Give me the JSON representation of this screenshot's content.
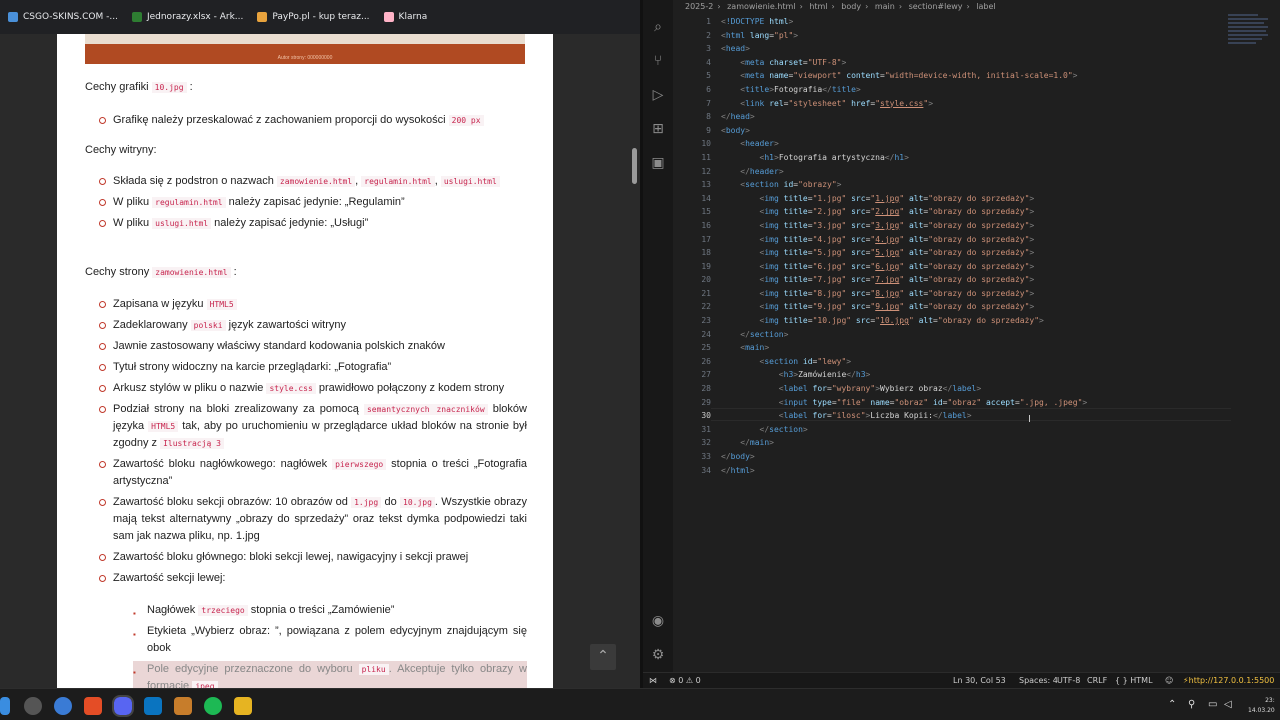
{
  "bookmarks": [
    {
      "label": "CSGO-SKINS.COM -...",
      "color": "#4a90d9"
    },
    {
      "label": "Jednorazy.xlsx - Ark...",
      "color": "#2e7d32"
    },
    {
      "label": "PayPo.pl - kup teraz...",
      "color": "#e8a33d"
    },
    {
      "label": "Klarna",
      "color": "#ffb3c7"
    }
  ],
  "doc": {
    "banner_text": "Autor strony: 000000000",
    "h1_pre": "Cechy grafiki",
    "h1_code": "10.jpg",
    "h1_post": ":",
    "grafika_pre": "Grafikę należy przeskalować z zachowaniem proporcji do wysokości",
    "grafika_code": "200 px",
    "h2": "Cechy witryny:",
    "w1_pre": "Składa się z podstron o nazwach",
    "w1_c1": "zamowienie.html",
    "w1_c2": "regulamin.html",
    "w1_c3": "uslugi.html",
    "w2_pre": "W pliku",
    "w2_code": "regulamin.html",
    "w2_post": "należy zapisać jedynie: „Regulamin”",
    "w3_pre": "W pliku",
    "w3_code": "uslugi.html",
    "w3_post": "należy zapisać jedynie: „Usługi”",
    "h3_pre": "Cechy strony",
    "h3_code": "zamowienie.html",
    "h3_post": ":",
    "s1_pre": "Zapisana w języku",
    "s1_code": "HTML5",
    "s2_pre": "Zadeklarowany",
    "s2_code": "polski",
    "s2_post": "język zawartości witryny",
    "s3": "Jawnie zastosowany właściwy standard kodowania polskich znaków",
    "s4": "Tytuł strony widoczny na karcie przeglądarki: „Fotografia”",
    "s5_pre": "Arkusz stylów w pliku o nazwie",
    "s5_code": "style.css",
    "s5_post": "prawidłowo połączony z kodem strony",
    "s6_pre": "Podział strony na bloki zrealizowany za pomocą",
    "s6_code": "semantycznych znaczników",
    "s6_mid": "bloków języka",
    "s6_code2": "HTML5",
    "s6_post": "tak, aby po uruchomieniu w przeglądarce układ bloków na stronie był zgodny z",
    "s6_code3": "Ilustracją 3",
    "s7_pre": "Zawartość bloku nagłówkowego: nagłówek",
    "s7_code": "pierwszego",
    "s7_post": "stopnia o treści „Fotografia artystyczna”",
    "s8_pre": "Zawartość bloku sekcji obrazów: 10 obrazów od",
    "s8_c1": "1.jpg",
    "s8_mid": "do",
    "s8_c2": "10.jpg",
    "s8_post": ". Wszystkie obrazy mają tekst alternatywny „obrazy do sprzedaży” oraz tekst dymka podpowiedzi taki sam jak nazwa pliku, np. 1.jpg",
    "s9": "Zawartość bloku głównego: bloki sekcji lewej, nawigacyjny i sekcji prawej",
    "s10": "Zawartość sekcji lewej:",
    "sub1_pre": "Nagłówek",
    "sub1_code": "trzeciego",
    "sub1_post": "stopnia o treści „Zamówienie”",
    "sub2": "Etykieta „Wybierz obraz: ”, powiązana z polem edycyjnym znajdującym się obok",
    "sub3_pre": "Pole edycyjne przeznaczone do wyboru",
    "sub3_code": "pliku",
    "sub3_post": ". Akceptuje tylko obrazy w formacie",
    "sub3_code2": "jpeg"
  },
  "editor": {
    "breadcrumb": [
      "2025-2",
      "›",
      "zamowienie.html",
      "›",
      "html",
      "›",
      "body",
      "›",
      "main",
      "›",
      "section#lewy",
      "›",
      "label"
    ],
    "lines": [
      {
        "n": "1",
        "html": "<span class='pu'>&lt;</span><span class='tg'>!DOCTYPE</span> <span class='at'>html</span><span class='pu'>&gt;</span>"
      },
      {
        "n": "2",
        "html": "<span class='pu'>&lt;</span><span class='tg'>html</span> <span class='at'>lang</span>=<span class='st'>\"pl\"</span><span class='pu'>&gt;</span>"
      },
      {
        "n": "3",
        "html": "<span class='pu'>&lt;</span><span class='tg'>head</span><span class='pu'>&gt;</span>"
      },
      {
        "n": "4",
        "html": "    <span class='pu'>&lt;</span><span class='tg'>meta</span> <span class='at'>charset</span>=<span class='st'>\"UTF-8\"</span><span class='pu'>&gt;</span>"
      },
      {
        "n": "5",
        "html": "    <span class='pu'>&lt;</span><span class='tg'>meta</span> <span class='at'>name</span>=<span class='st'>\"viewport\"</span> <span class='at'>content</span>=<span class='st'>\"width=device-width, initial-scale=1.0\"</span><span class='pu'>&gt;</span>"
      },
      {
        "n": "6",
        "html": "    <span class='pu'>&lt;</span><span class='tg'>title</span><span class='pu'>&gt;</span>Fotografia<span class='pu'>&lt;/</span><span class='tg'>title</span><span class='pu'>&gt;</span>"
      },
      {
        "n": "7",
        "html": "    <span class='pu'>&lt;</span><span class='tg'>link</span> <span class='at'>rel</span>=<span class='st'>\"stylesheet\"</span> <span class='at'>href</span>=<span class='st'>\"<span class='u'>style.css</span>\"</span><span class='pu'>&gt;</span>"
      },
      {
        "n": "8",
        "html": "<span class='pu'>&lt;/</span><span class='tg'>head</span><span class='pu'>&gt;</span>"
      },
      {
        "n": "9",
        "html": "<span class='pu'>&lt;</span><span class='tg'>body</span><span class='pu'>&gt;</span>"
      },
      {
        "n": "10",
        "html": "    <span class='pu'>&lt;</span><span class='tg'>header</span><span class='pu'>&gt;</span>"
      },
      {
        "n": "11",
        "html": "        <span class='pu'>&lt;</span><span class='tg'>h1</span><span class='pu'>&gt;</span>Fotografia artystyczna<span class='pu'>&lt;/</span><span class='tg'>h1</span><span class='pu'>&gt;</span>"
      },
      {
        "n": "12",
        "html": "    <span class='pu'>&lt;/</span><span class='tg'>header</span><span class='pu'>&gt;</span>"
      },
      {
        "n": "13",
        "html": "    <span class='pu'>&lt;</span><span class='tg'>section</span> <span class='at'>id</span>=<span class='st'>\"obrazy\"</span><span class='pu'>&gt;</span>"
      },
      {
        "n": "14",
        "html": "        <span class='pu'>&lt;</span><span class='tg'>img</span> <span class='at'>title</span>=<span class='st'>\"1.jpg\"</span> <span class='at'>src</span>=<span class='st'>\"<span class='u'>1.jpg</span>\"</span> <span class='at'>alt</span>=<span class='st'>\"obrazy do sprzedaży\"</span><span class='pu'>&gt;</span>"
      },
      {
        "n": "15",
        "html": "        <span class='pu'>&lt;</span><span class='tg'>img</span> <span class='at'>title</span>=<span class='st'>\"2.jpg\"</span> <span class='at'>src</span>=<span class='st'>\"<span class='u'>2.jpg</span>\"</span> <span class='at'>alt</span>=<span class='st'>\"obrazy do sprzedaży\"</span><span class='pu'>&gt;</span>"
      },
      {
        "n": "16",
        "html": "        <span class='pu'>&lt;</span><span class='tg'>img</span> <span class='at'>title</span>=<span class='st'>\"3.jpg\"</span> <span class='at'>src</span>=<span class='st'>\"<span class='u'>3.jpg</span>\"</span> <span class='at'>alt</span>=<span class='st'>\"obrazy do sprzedaży\"</span><span class='pu'>&gt;</span>"
      },
      {
        "n": "17",
        "html": "        <span class='pu'>&lt;</span><span class='tg'>img</span> <span class='at'>title</span>=<span class='st'>\"4.jpg\"</span> <span class='at'>src</span>=<span class='st'>\"<span class='u'>4.jpg</span>\"</span> <span class='at'>alt</span>=<span class='st'>\"obrazy do sprzedaży\"</span><span class='pu'>&gt;</span>"
      },
      {
        "n": "18",
        "html": "        <span class='pu'>&lt;</span><span class='tg'>img</span> <span class='at'>title</span>=<span class='st'>\"5.jpg\"</span> <span class='at'>src</span>=<span class='st'>\"<span class='u'>5.jpg</span>\"</span> <span class='at'>alt</span>=<span class='st'>\"obrazy do sprzedaży\"</span><span class='pu'>&gt;</span>"
      },
      {
        "n": "19",
        "html": "        <span class='pu'>&lt;</span><span class='tg'>img</span> <span class='at'>title</span>=<span class='st'>\"6.jpg\"</span> <span class='at'>src</span>=<span class='st'>\"<span class='u'>6.jpg</span>\"</span> <span class='at'>alt</span>=<span class='st'>\"obrazy do sprzedaży\"</span><span class='pu'>&gt;</span>"
      },
      {
        "n": "20",
        "html": "        <span class='pu'>&lt;</span><span class='tg'>img</span> <span class='at'>title</span>=<span class='st'>\"7.jpg\"</span> <span class='at'>src</span>=<span class='st'>\"<span class='u'>7.jpg</span>\"</span> <span class='at'>alt</span>=<span class='st'>\"obrazy do sprzedaży\"</span><span class='pu'>&gt;</span>"
      },
      {
        "n": "21",
        "html": "        <span class='pu'>&lt;</span><span class='tg'>img</span> <span class='at'>title</span>=<span class='st'>\"8.jpg\"</span> <span class='at'>src</span>=<span class='st'>\"<span class='u'>8.jpg</span>\"</span> <span class='at'>alt</span>=<span class='st'>\"obrazy do sprzedaży\"</span><span class='pu'>&gt;</span>"
      },
      {
        "n": "22",
        "html": "        <span class='pu'>&lt;</span><span class='tg'>img</span> <span class='at'>title</span>=<span class='st'>\"9.jpg\"</span> <span class='at'>src</span>=<span class='st'>\"<span class='u'>9.jpg</span>\"</span> <span class='at'>alt</span>=<span class='st'>\"obrazy do sprzedaży\"</span><span class='pu'>&gt;</span>"
      },
      {
        "n": "23",
        "html": "        <span class='pu'>&lt;</span><span class='tg'>img</span> <span class='at'>title</span>=<span class='st'>\"10.jpg\"</span> <span class='at'>src</span>=<span class='st'>\"<span class='u'>10.jpg</span>\"</span> <span class='at'>alt</span>=<span class='st'>\"obrazy do sprzedaży\"</span><span class='pu'>&gt;</span>"
      },
      {
        "n": "24",
        "html": "    <span class='pu'>&lt;/</span><span class='tg'>section</span><span class='pu'>&gt;</span>"
      },
      {
        "n": "25",
        "html": "    <span class='pu'>&lt;</span><span class='tg'>main</span><span class='pu'>&gt;</span>"
      },
      {
        "n": "26",
        "html": "        <span class='pu'>&lt;</span><span class='tg'>section</span> <span class='at'>id</span>=<span class='st'>\"lewy\"</span><span class='pu'>&gt;</span>"
      },
      {
        "n": "27",
        "html": "            <span class='pu'>&lt;</span><span class='tg'>h3</span><span class='pu'>&gt;</span>Zamówienie<span class='pu'>&lt;/</span><span class='tg'>h3</span><span class='pu'>&gt;</span>"
      },
      {
        "n": "28",
        "html": "            <span class='pu'>&lt;</span><span class='tg'>label</span> <span class='at'>for</span>=<span class='st'>\"wybrany\"</span><span class='pu'>&gt;</span>Wybierz obraz<span class='pu'>&lt;/</span><span class='tg'>label</span><span class='pu'>&gt;</span>"
      },
      {
        "n": "29",
        "html": "            <span class='pu'>&lt;</span><span class='tg'>input</span> <span class='at'>type</span>=<span class='st'>\"file\"</span> <span class='at'>name</span>=<span class='st'>\"obraz\"</span> <span class='at'>id</span>=<span class='st'>\"obraz\"</span> <span class='at'>accept</span>=<span class='st'>\".jpg, .jpeg\"</span><span class='pu'>&gt;</span>"
      },
      {
        "n": "30",
        "html": "            <span class='pu'>&lt;</span><span class='tg'>label</span> <span class='at'>for</span>=<span class='st'>\"ilosc\"</span><span class='pu'>&gt;</span>Liczba Kopii:<span class='pu'>&lt;/</span><span class='tg'>label</span><span class='pu'>&gt;</span>"
      },
      {
        "n": "31",
        "html": "        <span class='pu'>&lt;/</span><span class='tg'>section</span><span class='pu'>&gt;</span>"
      },
      {
        "n": "32",
        "html": "    <span class='pu'>&lt;/</span><span class='tg'>main</span><span class='pu'>&gt;</span>"
      },
      {
        "n": "33",
        "html": "<span class='pu'>&lt;/</span><span class='tg'>body</span><span class='pu'>&gt;</span>"
      },
      {
        "n": "34",
        "html": "<span class='pu'>&lt;/</span><span class='tg'>html</span><span class='pu'>&gt;</span>"
      }
    ],
    "current_line": "30"
  },
  "status": {
    "errors": "⊗ 0 ⚠ 0",
    "position": "Ln 30, Col 53",
    "spaces": "Spaces: 4",
    "encoding": "UTF-8",
    "eol": "CRLF",
    "language": "{ } HTML",
    "live_server": "http://127.0.0.1:5500"
  },
  "clock": {
    "time": "23:",
    "date": "14.03.20"
  }
}
